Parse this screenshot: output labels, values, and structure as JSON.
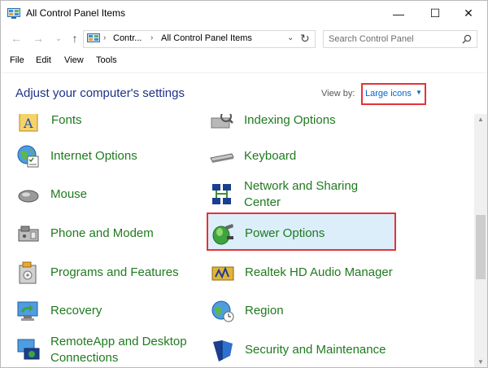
{
  "window": {
    "title": "All Control Panel Items",
    "controls": {
      "minimize": "—",
      "maximize": "☐",
      "close": "✕"
    }
  },
  "navigation": {
    "back": "←",
    "forward": "→",
    "recent": "⌄",
    "up": "↑",
    "address_crumbs": [
      "Contr...",
      "All Control Panel Items"
    ],
    "address_separator": "›",
    "address_dropdown": "⌄",
    "refresh": "↻",
    "search_placeholder": "Search Control Panel"
  },
  "menu": [
    "File",
    "Edit",
    "View",
    "Tools"
  ],
  "header": {
    "title": "Adjust your computer's settings",
    "view_by_label": "View by:",
    "view_by_value": "Large icons",
    "view_by_caret": "▼"
  },
  "items": [
    {
      "label": "Fonts",
      "icon": "fonts-icon"
    },
    {
      "label": "Indexing Options",
      "icon": "indexing-icon"
    },
    {
      "label": "Internet Options",
      "icon": "internet-options-icon"
    },
    {
      "label": "Keyboard",
      "icon": "keyboard-icon"
    },
    {
      "label": "Mouse",
      "icon": "mouse-icon"
    },
    {
      "label": "Network and Sharing Center",
      "icon": "network-icon"
    },
    {
      "label": "Phone and Modem",
      "icon": "phone-modem-icon"
    },
    {
      "label": "Power Options",
      "icon": "power-options-icon"
    },
    {
      "label": "Programs and Features",
      "icon": "programs-icon"
    },
    {
      "label": "Realtek HD Audio Manager",
      "icon": "audio-icon"
    },
    {
      "label": "Recovery",
      "icon": "recovery-icon"
    },
    {
      "label": "Region",
      "icon": "region-icon"
    },
    {
      "label": "RemoteApp and Desktop Connections",
      "icon": "remoteapp-icon"
    },
    {
      "label": "Security and Maintenance",
      "icon": "security-icon"
    }
  ],
  "scrollbar": {
    "up": "▲",
    "down": "▼"
  },
  "colors": {
    "link_green": "#1f7a1f",
    "header_blue": "#1e3287",
    "highlight_red": "#e53238",
    "selection_blue": "#dbeefa"
  }
}
